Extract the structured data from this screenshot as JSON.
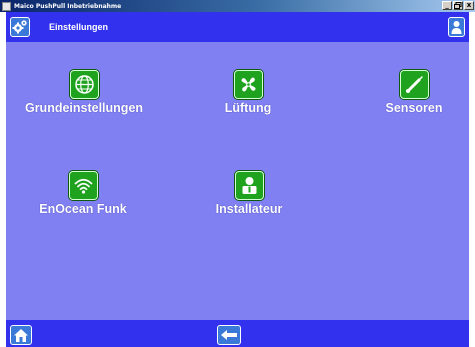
{
  "window": {
    "title": "Maico PushPull Inbetriebnahme",
    "controls": {
      "minimize": "_",
      "maximize": " ",
      "close": "x"
    }
  },
  "header": {
    "title": "Einstellungen",
    "left_icon": "settings-gears-icon",
    "right_icon": "user-icon"
  },
  "tiles": [
    {
      "label": "Grundeinstellungen",
      "icon": "globe-icon"
    },
    {
      "label": "Lüftung",
      "icon": "fan-icon"
    },
    {
      "label": "Sensoren",
      "icon": "sensor-probe-icon"
    },
    {
      "label": "EnOcean Funk",
      "icon": "wireless-signal-icon"
    },
    {
      "label": "Installateur",
      "icon": "installer-person-icon"
    }
  ],
  "footer": {
    "left_icon": "home-icon",
    "center_icon": "back-arrow-icon"
  },
  "colors": {
    "background": "#8080f2",
    "bar": "#3232ee",
    "tile_icon": "#1fa31f",
    "button": "#3a79d8",
    "label": "#ffffff"
  }
}
